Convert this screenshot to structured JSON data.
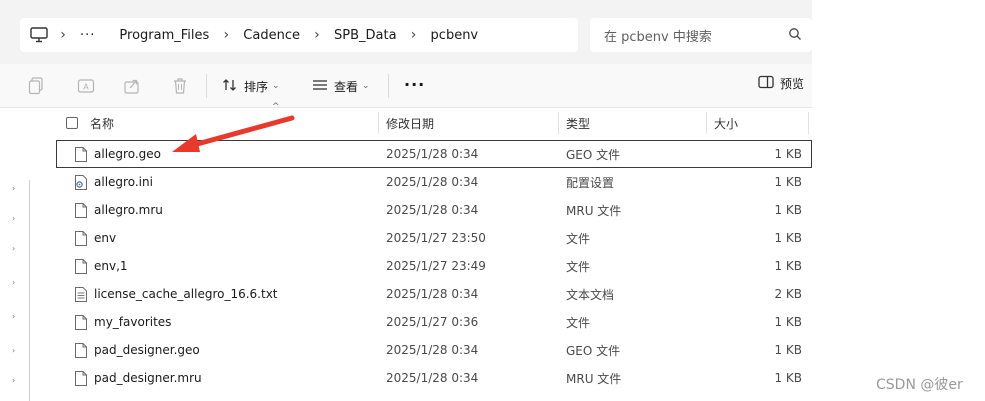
{
  "address_bar": {
    "breadcrumb": [
      "···",
      "Program_Files",
      "Cadence",
      "SPB_Data",
      "pcbenv"
    ],
    "search_placeholder": "在 pcbenv 中搜索"
  },
  "toolbar": {
    "sort_label": "排序",
    "view_label": "查看",
    "more_label": "···",
    "preview_label": "预览"
  },
  "columns": {
    "name": "名称",
    "date": "修改日期",
    "type": "类型",
    "size": "大小"
  },
  "files": [
    {
      "name": "allegro.geo",
      "date": "2025/1/28 0:34",
      "type": "GEO 文件",
      "size": "1 KB",
      "icon": "blank-file-icon",
      "selected": true
    },
    {
      "name": "allegro.ini",
      "date": "2025/1/28 0:34",
      "type": "配置设置",
      "size": "1 KB",
      "icon": "config-file-icon",
      "selected": false
    },
    {
      "name": "allegro.mru",
      "date": "2025/1/28 0:34",
      "type": "MRU 文件",
      "size": "1 KB",
      "icon": "blank-file-icon",
      "selected": false
    },
    {
      "name": "env",
      "date": "2025/1/27 23:50",
      "type": "文件",
      "size": "1 KB",
      "icon": "blank-file-icon",
      "selected": false
    },
    {
      "name": "env,1",
      "date": "2025/1/27 23:49",
      "type": "文件",
      "size": "1 KB",
      "icon": "blank-file-icon",
      "selected": false
    },
    {
      "name": "license_cache_allegro_16.6.txt",
      "date": "2025/1/28 0:34",
      "type": "文本文档",
      "size": "2 KB",
      "icon": "text-file-icon",
      "selected": false
    },
    {
      "name": "my_favorites",
      "date": "2025/1/27 0:36",
      "type": "文件",
      "size": "1 KB",
      "icon": "blank-file-icon",
      "selected": false
    },
    {
      "name": "pad_designer.geo",
      "date": "2025/1/28 0:34",
      "type": "GEO 文件",
      "size": "1 KB",
      "icon": "blank-file-icon",
      "selected": false
    },
    {
      "name": "pad_designer.mru",
      "date": "2025/1/28 0:34",
      "type": "MRU 文件",
      "size": "1 KB",
      "icon": "blank-file-icon",
      "selected": false
    }
  ],
  "annotation_color": "#e8392d",
  "watermark": "CSDN @彼er"
}
